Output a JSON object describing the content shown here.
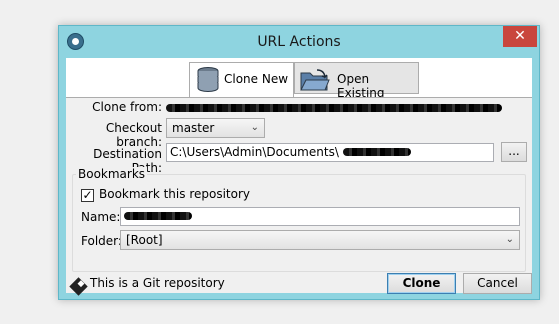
{
  "window": {
    "title": "URL Actions",
    "close_glyph": "✕"
  },
  "tabs": [
    {
      "label": "Clone New",
      "icon": "database-icon",
      "active": true
    },
    {
      "label": "Open Existing",
      "icon": "folder-open-icon",
      "active": false
    }
  ],
  "form": {
    "clone_from_label": "Clone from:",
    "checkout_branch_label": "Checkout branch:",
    "checkout_branch_value": "master",
    "destination_label": "Destination Path:",
    "destination_value": "C:\\Users\\Admin\\Documents\\",
    "browse_label": "..."
  },
  "bookmarks": {
    "group_title": "Bookmarks",
    "bookmark_checkbox_label": "Bookmark this repository",
    "bookmark_checked": true,
    "name_label": "Name:",
    "folder_label": "Folder:",
    "folder_value": "[Root]"
  },
  "status": {
    "text": "This is a Git repository"
  },
  "buttons": {
    "clone": "Clone",
    "cancel": "Cancel"
  },
  "colors": {
    "titlebar": "#8ed4e0",
    "close_button": "#c9463d"
  }
}
